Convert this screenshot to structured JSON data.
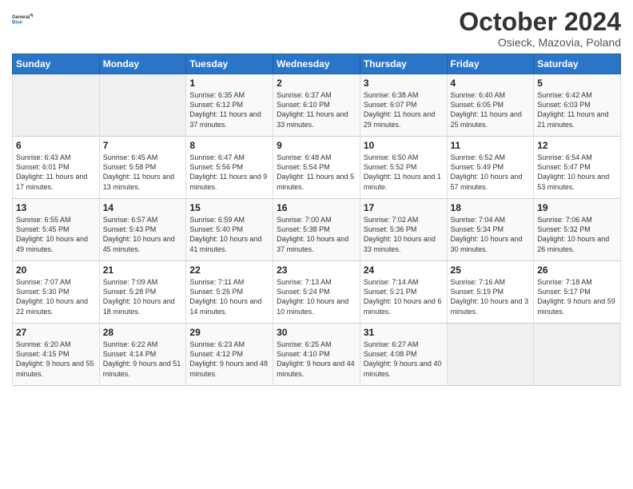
{
  "header": {
    "logo_line1": "General",
    "logo_line2": "Blue",
    "month": "October 2024",
    "location": "Osieck, Mazovia, Poland"
  },
  "days_of_week": [
    "Sunday",
    "Monday",
    "Tuesday",
    "Wednesday",
    "Thursday",
    "Friday",
    "Saturday"
  ],
  "weeks": [
    [
      {
        "day": "",
        "info": ""
      },
      {
        "day": "",
        "info": ""
      },
      {
        "day": "1",
        "info": "Sunrise: 6:35 AM\nSunset: 6:12 PM\nDaylight: 11 hours and 37 minutes."
      },
      {
        "day": "2",
        "info": "Sunrise: 6:37 AM\nSunset: 6:10 PM\nDaylight: 11 hours and 33 minutes."
      },
      {
        "day": "3",
        "info": "Sunrise: 6:38 AM\nSunset: 6:07 PM\nDaylight: 11 hours and 29 minutes."
      },
      {
        "day": "4",
        "info": "Sunrise: 6:40 AM\nSunset: 6:05 PM\nDaylight: 11 hours and 25 minutes."
      },
      {
        "day": "5",
        "info": "Sunrise: 6:42 AM\nSunset: 6:03 PM\nDaylight: 11 hours and 21 minutes."
      }
    ],
    [
      {
        "day": "6",
        "info": "Sunrise: 6:43 AM\nSunset: 6:01 PM\nDaylight: 11 hours and 17 minutes."
      },
      {
        "day": "7",
        "info": "Sunrise: 6:45 AM\nSunset: 5:58 PM\nDaylight: 11 hours and 13 minutes."
      },
      {
        "day": "8",
        "info": "Sunrise: 6:47 AM\nSunset: 5:56 PM\nDaylight: 11 hours and 9 minutes."
      },
      {
        "day": "9",
        "info": "Sunrise: 6:48 AM\nSunset: 5:54 PM\nDaylight: 11 hours and 5 minutes."
      },
      {
        "day": "10",
        "info": "Sunrise: 6:50 AM\nSunset: 5:52 PM\nDaylight: 11 hours and 1 minute."
      },
      {
        "day": "11",
        "info": "Sunrise: 6:52 AM\nSunset: 5:49 PM\nDaylight: 10 hours and 57 minutes."
      },
      {
        "day": "12",
        "info": "Sunrise: 6:54 AM\nSunset: 5:47 PM\nDaylight: 10 hours and 53 minutes."
      }
    ],
    [
      {
        "day": "13",
        "info": "Sunrise: 6:55 AM\nSunset: 5:45 PM\nDaylight: 10 hours and 49 minutes."
      },
      {
        "day": "14",
        "info": "Sunrise: 6:57 AM\nSunset: 5:43 PM\nDaylight: 10 hours and 45 minutes."
      },
      {
        "day": "15",
        "info": "Sunrise: 6:59 AM\nSunset: 5:40 PM\nDaylight: 10 hours and 41 minutes."
      },
      {
        "day": "16",
        "info": "Sunrise: 7:00 AM\nSunset: 5:38 PM\nDaylight: 10 hours and 37 minutes."
      },
      {
        "day": "17",
        "info": "Sunrise: 7:02 AM\nSunset: 5:36 PM\nDaylight: 10 hours and 33 minutes."
      },
      {
        "day": "18",
        "info": "Sunrise: 7:04 AM\nSunset: 5:34 PM\nDaylight: 10 hours and 30 minutes."
      },
      {
        "day": "19",
        "info": "Sunrise: 7:06 AM\nSunset: 5:32 PM\nDaylight: 10 hours and 26 minutes."
      }
    ],
    [
      {
        "day": "20",
        "info": "Sunrise: 7:07 AM\nSunset: 5:30 PM\nDaylight: 10 hours and 22 minutes."
      },
      {
        "day": "21",
        "info": "Sunrise: 7:09 AM\nSunset: 5:28 PM\nDaylight: 10 hours and 18 minutes."
      },
      {
        "day": "22",
        "info": "Sunrise: 7:11 AM\nSunset: 5:26 PM\nDaylight: 10 hours and 14 minutes."
      },
      {
        "day": "23",
        "info": "Sunrise: 7:13 AM\nSunset: 5:24 PM\nDaylight: 10 hours and 10 minutes."
      },
      {
        "day": "24",
        "info": "Sunrise: 7:14 AM\nSunset: 5:21 PM\nDaylight: 10 hours and 6 minutes."
      },
      {
        "day": "25",
        "info": "Sunrise: 7:16 AM\nSunset: 5:19 PM\nDaylight: 10 hours and 3 minutes."
      },
      {
        "day": "26",
        "info": "Sunrise: 7:18 AM\nSunset: 5:17 PM\nDaylight: 9 hours and 59 minutes."
      }
    ],
    [
      {
        "day": "27",
        "info": "Sunrise: 6:20 AM\nSunset: 4:15 PM\nDaylight: 9 hours and 55 minutes."
      },
      {
        "day": "28",
        "info": "Sunrise: 6:22 AM\nSunset: 4:14 PM\nDaylight: 9 hours and 51 minutes."
      },
      {
        "day": "29",
        "info": "Sunrise: 6:23 AM\nSunset: 4:12 PM\nDaylight: 9 hours and 48 minutes."
      },
      {
        "day": "30",
        "info": "Sunrise: 6:25 AM\nSunset: 4:10 PM\nDaylight: 9 hours and 44 minutes."
      },
      {
        "day": "31",
        "info": "Sunrise: 6:27 AM\nSunset: 4:08 PM\nDaylight: 9 hours and 40 minutes."
      },
      {
        "day": "",
        "info": ""
      },
      {
        "day": "",
        "info": ""
      }
    ]
  ]
}
